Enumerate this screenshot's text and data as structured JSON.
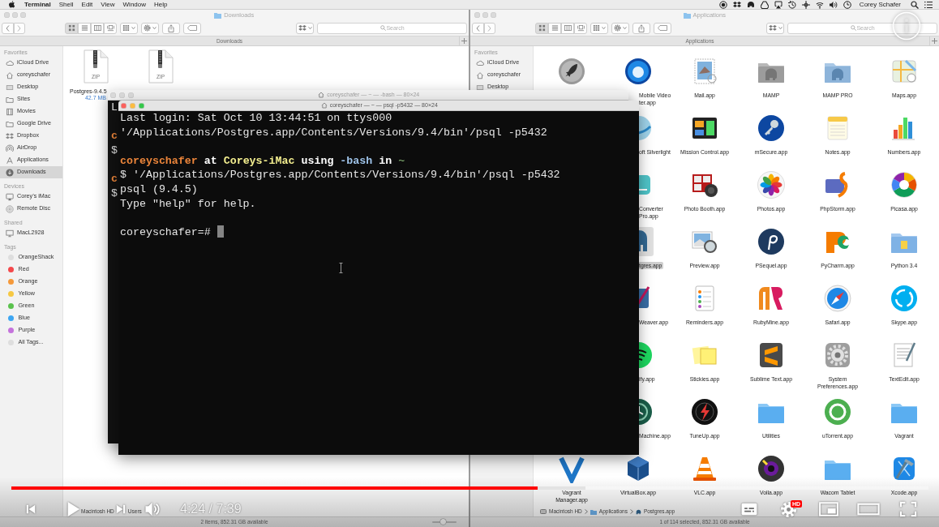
{
  "menu_bar": {
    "app": "Terminal",
    "menus": [
      "Shell",
      "Edit",
      "View",
      "Window",
      "Help"
    ],
    "user": "Corey Schafer"
  },
  "finders": [
    {
      "active": false,
      "title": "Downloads",
      "view_modes": [
        {
          "selected": true
        },
        {
          "selected": false
        },
        {
          "selected": false
        },
        {
          "selected": false
        }
      ],
      "search": {
        "placeholder": "Search"
      },
      "tab": "Downloads",
      "sidebar": [
        {
          "kind": "favorites",
          "heading": "Favorites",
          "items": [
            {
              "label": "iCloud Drive",
              "selected": false
            },
            {
              "label": "coreyschafer",
              "selected": false
            },
            {
              "label": "Desktop",
              "selected": false
            },
            {
              "label": "Sites",
              "selected": false
            },
            {
              "label": "Movies",
              "selected": false
            },
            {
              "label": "Google Drive",
              "selected": false
            },
            {
              "label": "Dropbox",
              "selected": false
            },
            {
              "label": "AirDrop",
              "selected": false
            },
            {
              "label": "Applications",
              "selected": false
            },
            {
              "label": "Downloads",
              "selected": true
            }
          ]
        },
        {
          "kind": "devices",
          "heading": "Devices",
          "items": [
            {
              "label": "Corey’s iMac",
              "selected": false
            },
            {
              "label": "Remote Disc",
              "selected": false
            }
          ]
        },
        {
          "kind": "shared",
          "heading": "Shared",
          "items": [
            {
              "label": "MacL2928",
              "selected": false
            }
          ]
        },
        {
          "kind": "tags",
          "heading": "Tags",
          "items": [
            {
              "label": "OrangeShack",
              "color": "#dedede",
              "selected": false
            },
            {
              "label": "Red",
              "color": "#f4484b",
              "selected": false
            },
            {
              "label": "Orange",
              "color": "#f5993a",
              "selected": false
            },
            {
              "label": "Yellow",
              "color": "#f6c843",
              "selected": false
            },
            {
              "label": "Green",
              "color": "#5ac24d",
              "selected": false
            },
            {
              "label": "Blue",
              "color": "#3da6f2",
              "selected": false
            },
            {
              "label": "Purple",
              "color": "#c473dc",
              "selected": false
            },
            {
              "label": "All Tags...",
              "color": "#dedede",
              "selected": false
            }
          ]
        }
      ],
      "files": [
        {
          "type_label": "ZIP",
          "name": "Postgres-9.4.5",
          "size": "42.7 MB",
          "selected": false
        },
        {
          "type_label": "ZIP",
          "selected": false
        }
      ],
      "path_bar": {
        "kind": "partial",
        "items": [
          "Macintosh HD",
          "Users"
        ]
      },
      "status": "2 items, 852.31 GB available",
      "size_slider": {
        "level": 0.45
      }
    },
    {
      "active": false,
      "title": "Applications",
      "view_modes": [
        {
          "selected": true
        },
        {
          "selected": false
        },
        {
          "selected": false
        },
        {
          "selected": false
        }
      ],
      "search": {
        "placeholder": "Search"
      },
      "tab": "Applications",
      "sidebar": [
        {
          "kind": "favorites",
          "heading": "Favorites",
          "items": [
            {
              "label": "iCloud Drive",
              "selected": false
            },
            {
              "label": "coreyschafer",
              "selected": false
            },
            {
              "label": "Desktop",
              "selected": false
            }
          ]
        }
      ],
      "apps": [
        [
          {
            "kind": "app",
            "selected": false
          },
          {
            "kind": "edge-label",
            "label": [
              "Mobile Video",
              "ter.app"
            ],
            "selected": false
          },
          {
            "kind": "app",
            "label": [
              "Mail.app"
            ],
            "selected": false
          },
          {
            "kind": "app",
            "label": [
              "MAMP"
            ],
            "selected": false
          },
          {
            "kind": "app",
            "label": [
              "MAMP PRO"
            ],
            "selected": false
          },
          {
            "kind": "app",
            "label": [
              "Maps.app"
            ],
            "selected": false
          }
        ],
        [
          {
            "kind": "covered"
          },
          {
            "kind": "edge",
            "label": [
              "oft Silverlight"
            ],
            "selected": false
          },
          {
            "kind": "app",
            "label": [
              "Mission Control.app"
            ],
            "selected": false
          },
          {
            "kind": "app",
            "label": [
              "mSecure.app"
            ],
            "selected": false
          },
          {
            "kind": "app",
            "label": [
              "Notes.app"
            ],
            "selected": false
          },
          {
            "kind": "app",
            "label": [
              "Numbers.app"
            ],
            "selected": false
          }
        ],
        [
          {
            "kind": "covered"
          },
          {
            "kind": "edge",
            "label": [
              "Converter",
              "Pro.app"
            ],
            "selected": false
          },
          {
            "kind": "app",
            "label": [
              "Photo Booth.app"
            ],
            "selected": false
          },
          {
            "kind": "app",
            "label": [
              "Photos.app"
            ],
            "selected": false
          },
          {
            "kind": "app",
            "label": [
              "PhpStorm.app"
            ],
            "selected": false
          },
          {
            "kind": "app",
            "label": [
              "Picasa.app"
            ],
            "selected": false
          }
        ],
        [
          {
            "kind": "covered"
          },
          {
            "kind": "edge",
            "label": [
              "tgres.app"
            ],
            "selected": true
          },
          {
            "kind": "app",
            "label": [
              "Preview.app"
            ],
            "selected": false
          },
          {
            "kind": "app",
            "label": [
              "PSequel.app"
            ],
            "selected": false
          },
          {
            "kind": "app",
            "label": [
              "PyCharm.app"
            ],
            "selected": false
          },
          {
            "kind": "app",
            "label": [
              "Python 3.4"
            ],
            "selected": false
          }
        ],
        [
          {
            "kind": "covered"
          },
          {
            "kind": "edge",
            "label": [
              "Weaver.app"
            ],
            "selected": false
          },
          {
            "kind": "app",
            "label": [
              "Reminders.app"
            ],
            "selected": false
          },
          {
            "kind": "app",
            "label": [
              "RubyMine.app"
            ],
            "selected": false
          },
          {
            "kind": "app",
            "label": [
              "Safari.app"
            ],
            "selected": false
          },
          {
            "kind": "app",
            "label": [
              "Skype.app"
            ],
            "selected": false
          }
        ],
        [
          {
            "kind": "covered"
          },
          {
            "kind": "edge",
            "label": [
              "ify.app"
            ],
            "selected": false
          },
          {
            "kind": "app",
            "label": [
              "Stickies.app"
            ],
            "selected": false
          },
          {
            "kind": "app",
            "label": [
              "Sublime Text.app"
            ],
            "selected": false
          },
          {
            "kind": "app",
            "label": [
              "System",
              "Preferences.app"
            ],
            "selected": false
          },
          {
            "kind": "app",
            "label": [
              "TextEdit.app"
            ],
            "selected": false
          }
        ],
        [
          {
            "kind": "covered"
          },
          {
            "kind": "edge",
            "label": [
              "Machine.app"
            ],
            "selected": false
          },
          {
            "kind": "app",
            "label": [
              "TuneUp.app"
            ],
            "selected": false
          },
          {
            "kind": "app",
            "label": [
              "Utilities"
            ],
            "selected": false
          },
          {
            "kind": "app",
            "label": [
              "uTorrent.app"
            ],
            "selected": false
          },
          {
            "kind": "app",
            "label": [
              "Vagrant"
            ],
            "selected": false
          }
        ],
        [
          {
            "kind": "app",
            "label": [
              "Vagrant",
              "Manager.app"
            ],
            "selected": false
          },
          {
            "kind": "app",
            "label": [
              "VirtualBox.app"
            ],
            "selected": false
          },
          {
            "kind": "app",
            "label": [
              "VLC.app"
            ],
            "selected": false
          },
          {
            "kind": "app",
            "label": [
              "Voila.app"
            ],
            "selected": false
          },
          {
            "kind": "app",
            "label": [
              "Wacom Tablet"
            ],
            "selected": false
          },
          {
            "kind": "app",
            "label": [
              "Xcode.app"
            ],
            "selected": false
          }
        ]
      ],
      "path_bar": {
        "kind": "full",
        "items": [
          "Macintosh HD",
          "Applications",
          "Postgres.app"
        ]
      },
      "status": "1 of 114 selected, 852.31 GB available"
    }
  ],
  "terminals": [
    {
      "active": false,
      "title": "coreyschafer — ~ — -bash — 80×24",
      "edge_lines": [
        {
          "kind": "text",
          "text": "L"
        },
        {
          "kind": "blank"
        },
        {
          "kind": "prompt",
          "text": "c"
        },
        {
          "kind": "text",
          "text": "$"
        },
        {
          "kind": "blank"
        },
        {
          "kind": "prompt",
          "text": "c"
        },
        {
          "kind": "text",
          "text": "$"
        }
      ]
    },
    {
      "active": true,
      "title": "coreyschafer — ~ — psql -p5432 — 80×24",
      "lines": [
        {
          "kind": "output",
          "text": "Last login: Sat Oct 10 13:44:51 on ttys000"
        },
        {
          "kind": "output",
          "text": "'/Applications/Postgres.app/Contents/Versions/9.4/bin'/psql -p5432"
        },
        {
          "kind": "blank"
        },
        {
          "kind": "prompt",
          "segments": [
            {
              "kind": "user",
              "text": "coreyschafer"
            },
            {
              "kind": "word",
              "text": "at"
            },
            {
              "kind": "host",
              "text": "Coreys-iMac"
            },
            {
              "kind": "word",
              "text": "using"
            },
            {
              "kind": "shell",
              "text": "-bash"
            },
            {
              "kind": "word",
              "text": "in"
            },
            {
              "kind": "dir",
              "text": "~"
            }
          ]
        },
        {
          "kind": "output",
          "text": "$ '/Applications/Postgres.app/Contents/Versions/9.4/bin'/psql -p5432"
        },
        {
          "kind": "output",
          "text": "psql (9.4.5)"
        },
        {
          "kind": "output",
          "text": "Type \"help\" for help."
        },
        {
          "kind": "blank"
        },
        {
          "kind": "input",
          "text": "coreyschafer=#",
          "cursor": true
        }
      ]
    }
  ],
  "video_player": {
    "progress": {
      "level": 0.574,
      "buffer": {
        "level": 0.626
      }
    },
    "playing": false,
    "time": "4:24 / 7:39",
    "quality": "HD"
  }
}
